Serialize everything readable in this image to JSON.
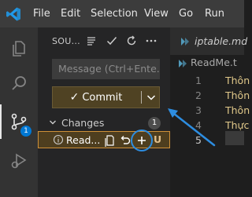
{
  "titlebar": {
    "logo_icon": "vscode-logo-icon",
    "menu": [
      "File",
      "Edit",
      "Selection",
      "View",
      "Go",
      "Run"
    ]
  },
  "activity": {
    "items": [
      {
        "icon": "explorer-icon"
      },
      {
        "icon": "search-icon"
      },
      {
        "icon": "source-control-icon",
        "badge": "1"
      },
      {
        "icon": "run-debug-icon"
      }
    ]
  },
  "scm": {
    "title": "SOU...",
    "toolbar_icons": [
      "view-as-list-icon",
      "commit-check-icon",
      "refresh-icon",
      "more-icon"
    ],
    "message_placeholder": "Message (Ctrl+Ente...",
    "commit_label": "Commit",
    "changes_label": "Changes",
    "changes_count": "1",
    "file": {
      "name": "Read...",
      "status": "U"
    }
  },
  "editor": {
    "tab_label": "iptable.md",
    "breadcrumb": "ReadMe.t",
    "lines": [
      {
        "num": "1",
        "text": "Thôn"
      },
      {
        "num": "2",
        "text": "Thôn"
      },
      {
        "num": "3",
        "text": "Thôn"
      },
      {
        "num": "4",
        "text": "Thực"
      },
      {
        "num": "5",
        "text": ""
      }
    ]
  },
  "colors": {
    "accent": "#0078d4",
    "commit_button": "#4f4223",
    "file_row_border": "#cf9038",
    "annotation": "#2d8de0"
  }
}
